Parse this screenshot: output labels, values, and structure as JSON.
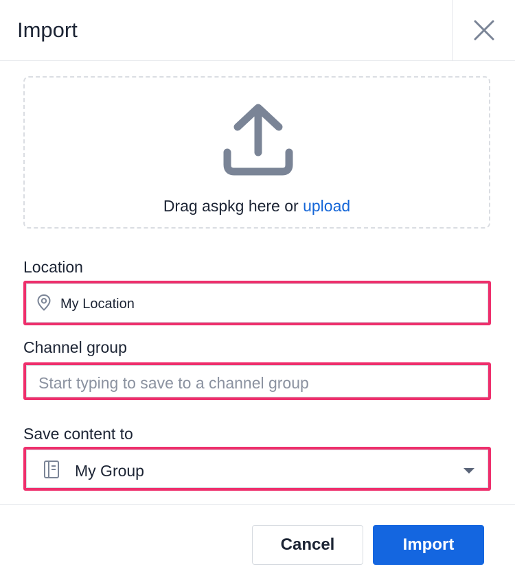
{
  "dialog": {
    "title": "Import",
    "close_icon": "close-icon"
  },
  "dropzone": {
    "icon": "upload-icon",
    "text": "Drag aspkg here or",
    "link": "upload"
  },
  "location": {
    "label": "Location",
    "icon": "map-pin-icon",
    "value": "My Location"
  },
  "channel_group": {
    "label": "Channel group",
    "value": "",
    "placeholder": "Start typing to save to a channel group"
  },
  "save_content": {
    "label": "Save content to",
    "icon": "notebook-icon",
    "selected": "My Group",
    "caret_icon": "caret-down-icon"
  },
  "footer": {
    "cancel_label": "Cancel",
    "import_label": "Import"
  },
  "colors": {
    "accent": "#1466e0",
    "link": "#1466d8",
    "highlight": "#ee2f6c",
    "icon_gray": "#7a8496"
  }
}
